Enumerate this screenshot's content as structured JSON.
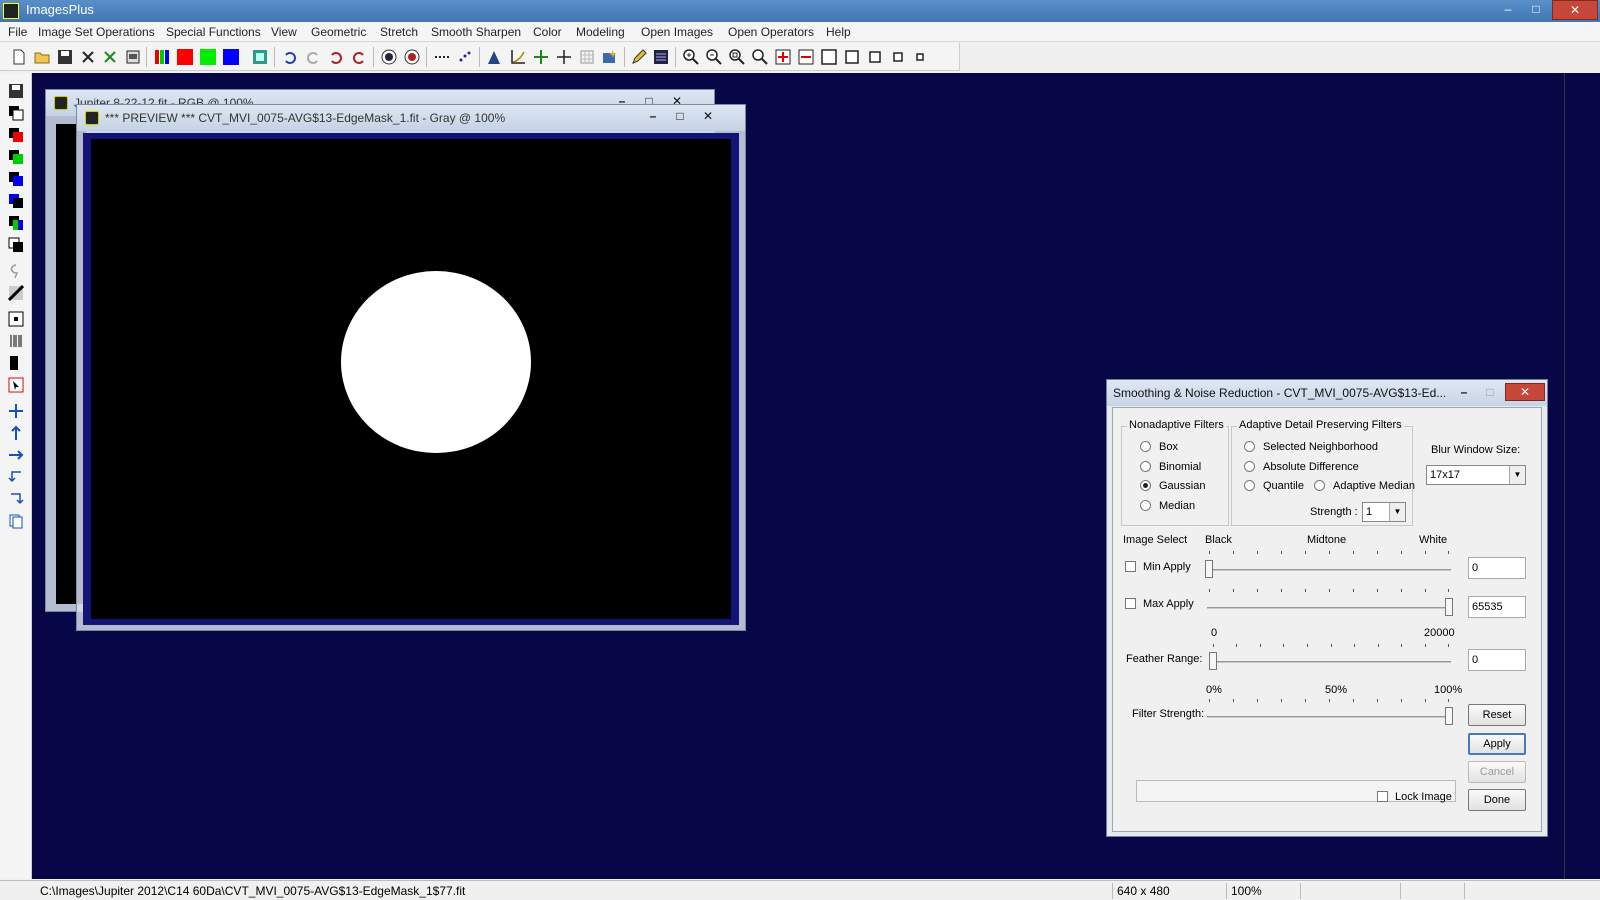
{
  "app": {
    "title": "ImagesPlus"
  },
  "menu": [
    "File",
    "Image Set Operations",
    "Special Functions",
    "View",
    "Geometric",
    "Stretch",
    "Smooth Sharpen",
    "Color",
    "Modeling",
    "Open Images",
    "Open Operators",
    "Help"
  ],
  "windows": {
    "back": {
      "title": "Jupiter 8-22-12.fit - RGB @ 100%"
    },
    "preview": {
      "title": "*** PREVIEW *** CVT_MVI_0075-AVG$13-EdgeMask_1.fit - Gray @ 100%"
    }
  },
  "dialog": {
    "title": "Smoothing & Noise Reduction - CVT_MVI_0075-AVG$13-Ed...",
    "nonadaptive": {
      "legend": "Nonadaptive Filters",
      "options": [
        {
          "label": "Box",
          "selected": false
        },
        {
          "label": "Binomial",
          "selected": false
        },
        {
          "label": "Gaussian",
          "selected": true
        },
        {
          "label": "Median",
          "selected": false
        }
      ]
    },
    "adaptive": {
      "legend": "Adaptive Detail Preserving Filters",
      "selected_neighborhood": "Selected Neighborhood",
      "absolute_difference": "Absolute Difference",
      "quantile": "Quantile",
      "adaptive_median": "Adaptive Median",
      "strength_label": "Strength :",
      "strength_value": "1"
    },
    "blur": {
      "label": "Blur Window Size:",
      "value": "17x17"
    },
    "image_select": {
      "label": "Image Select",
      "black": "Black",
      "midtone": "Midtone",
      "white": "White"
    },
    "min_apply": {
      "label": "Min Apply",
      "value": "0",
      "level": 0.0
    },
    "max_apply": {
      "label": "Max Apply",
      "value": "65535",
      "level": 1.0
    },
    "feather": {
      "label": "Feather Range:",
      "min": "0",
      "max": "20000",
      "value": "0",
      "level": 0.0
    },
    "filter_strength": {
      "label": "Filter Strength:",
      "p0": "0%",
      "p50": "50%",
      "p100": "100%",
      "level": 1.0
    },
    "buttons": {
      "reset": "Reset",
      "apply": "Apply",
      "cancel": "Cancel",
      "done": "Done"
    },
    "lock_image": "Lock Image"
  },
  "status": {
    "path": "C:\\Images\\Jupiter 2012\\C14 60Da\\CVT_MVI_0075-AVG$13-EdgeMask_1$77.fit",
    "size": "640 x 480",
    "zoom": "100%"
  }
}
